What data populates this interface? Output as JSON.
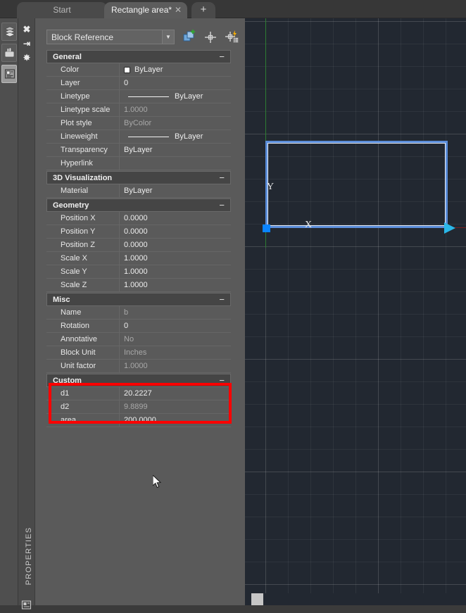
{
  "tabs": {
    "inactive_label": "Start",
    "active_label": "Rectangle area*",
    "close_glyph": "✕",
    "new_tab_glyph": "+"
  },
  "left_rail": {
    "items": [
      {
        "name": "layers-icon",
        "tooltip": "Layers"
      },
      {
        "name": "pan-hand-icon",
        "tooltip": "Pan"
      },
      {
        "name": "properties-icon",
        "tooltip": "Properties"
      }
    ]
  },
  "panel_strip": {
    "close_glyph": "✖",
    "autohide_glyph": "⇥",
    "settings_glyph": "✸",
    "vertical_label": "PROPERTIES"
  },
  "properties_panel": {
    "object_type": "Block Reference",
    "dropdown_arrow": "▼",
    "toolbar": {
      "select_objects": "Select Objects",
      "quick_select": "Quick Select",
      "quick_select_table": "Quick Select Table"
    },
    "collapse_glyph": "−",
    "categories": [
      {
        "title": "General",
        "rows": [
          {
            "label": "Color",
            "value": "ByLayer",
            "dim": false,
            "swatch": "#ffffff",
            "line": false
          },
          {
            "label": "Layer",
            "value": "0",
            "dim": false,
            "swatch": null,
            "line": false
          },
          {
            "label": "Linetype",
            "value": "ByLayer",
            "dim": false,
            "swatch": null,
            "line": true
          },
          {
            "label": "Linetype scale",
            "value": "1.0000",
            "dim": true,
            "swatch": null,
            "line": false
          },
          {
            "label": "Plot style",
            "value": "ByColor",
            "dim": true,
            "swatch": null,
            "line": false
          },
          {
            "label": "Lineweight",
            "value": "ByLayer",
            "dim": false,
            "swatch": null,
            "line": true
          },
          {
            "label": "Transparency",
            "value": "ByLayer",
            "dim": false,
            "swatch": null,
            "line": false
          },
          {
            "label": "Hyperlink",
            "value": "",
            "dim": false,
            "swatch": null,
            "line": false
          }
        ]
      },
      {
        "title": "3D Visualization",
        "rows": [
          {
            "label": "Material",
            "value": "ByLayer",
            "dim": false,
            "swatch": null,
            "line": false
          }
        ]
      },
      {
        "title": "Geometry",
        "rows": [
          {
            "label": "Position X",
            "value": "0.0000",
            "dim": false,
            "swatch": null,
            "line": false
          },
          {
            "label": "Position Y",
            "value": "0.0000",
            "dim": false,
            "swatch": null,
            "line": false
          },
          {
            "label": "Position Z",
            "value": "0.0000",
            "dim": false,
            "swatch": null,
            "line": false
          },
          {
            "label": "Scale X",
            "value": "1.0000",
            "dim": false,
            "swatch": null,
            "line": false
          },
          {
            "label": "Scale Y",
            "value": "1.0000",
            "dim": false,
            "swatch": null,
            "line": false
          },
          {
            "label": "Scale Z",
            "value": "1.0000",
            "dim": false,
            "swatch": null,
            "line": false
          }
        ]
      },
      {
        "title": "Misc",
        "rows": [
          {
            "label": "Name",
            "value": "b",
            "dim": true,
            "swatch": null,
            "line": false
          },
          {
            "label": "Rotation",
            "value": "0",
            "dim": false,
            "swatch": null,
            "line": false
          },
          {
            "label": "Annotative",
            "value": "No",
            "dim": true,
            "swatch": null,
            "line": false
          },
          {
            "label": "Block Unit",
            "value": "Inches",
            "dim": true,
            "swatch": null,
            "line": false
          },
          {
            "label": "Unit factor",
            "value": "1.0000",
            "dim": true,
            "swatch": null,
            "line": false
          }
        ]
      },
      {
        "title": "Custom",
        "rows": [
          {
            "label": "d1",
            "value": "20.2227",
            "dim": false,
            "swatch": null,
            "line": false
          },
          {
            "label": "d2",
            "value": "9.8899",
            "dim": true,
            "swatch": null,
            "line": false
          },
          {
            "label": "area",
            "value": "200.0000",
            "dim": false,
            "swatch": null,
            "line": false
          }
        ]
      }
    ],
    "highlight_color": "#fe0000"
  },
  "canvas": {
    "background": "#222831",
    "selection_color": "#5b8dd9",
    "grip_color": "#0a84ff",
    "arrow_grip_color": "#2ab7e8",
    "x_axis_color": "#7a2020",
    "y_axis_color": "#2e7d32",
    "ucs_x_label": "X",
    "ucs_y_label": "Y"
  }
}
